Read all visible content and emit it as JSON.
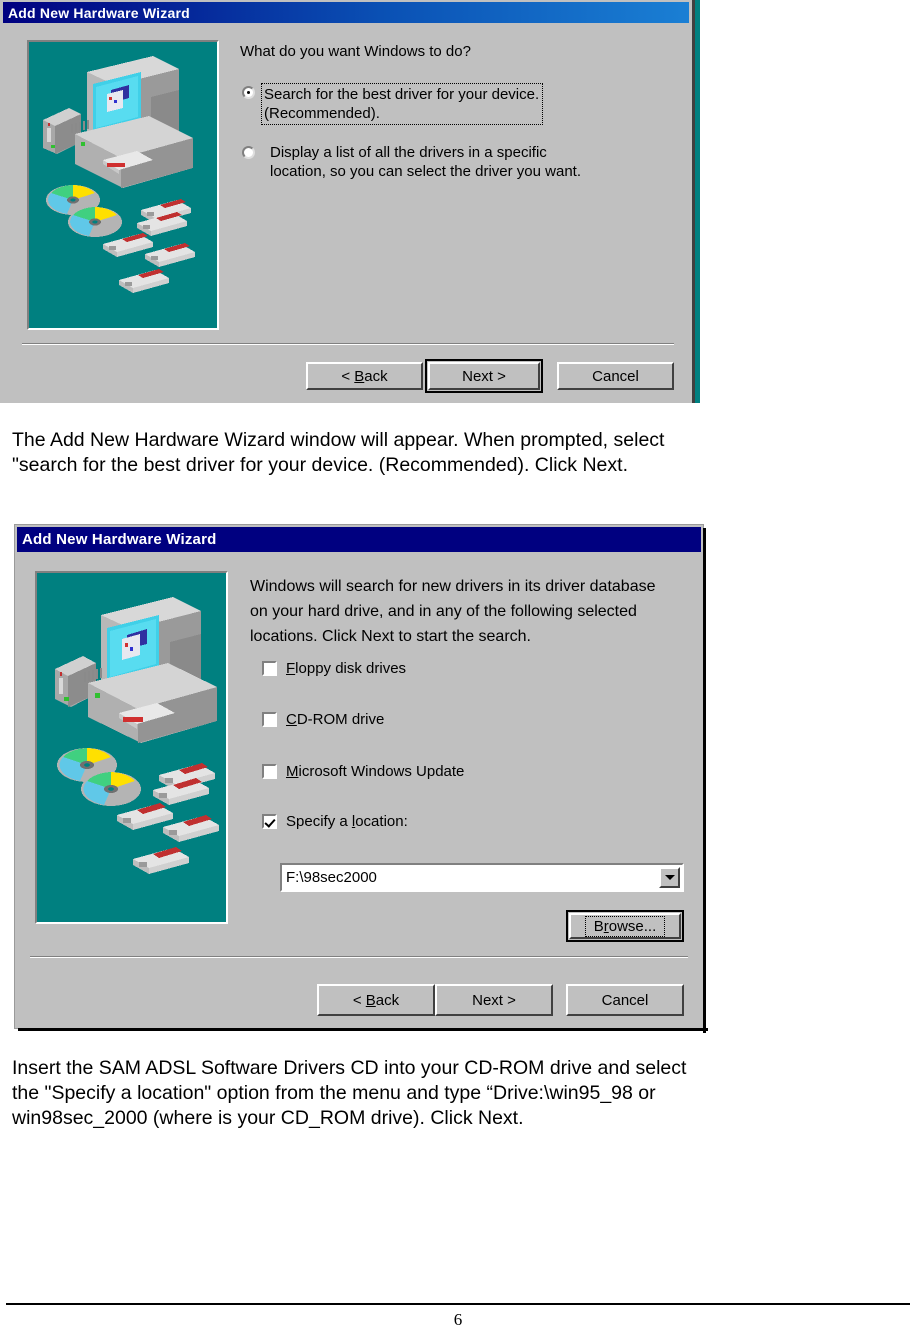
{
  "page": {
    "footer_page_number": "6"
  },
  "colors": {
    "titlebar_navy": "#000080",
    "titlebar_gradient_end": "#1a7fd4",
    "dialog_face": "#c0c0c0",
    "illustration_bg": "#008080",
    "text": "#000000"
  },
  "dialog1": {
    "title": "Add New Hardware Wizard",
    "prompt": "What do you want Windows to do?",
    "options": [
      {
        "label": "Search for the best driver for your device.\n(Recommended).",
        "selected": true,
        "focused": true
      },
      {
        "label": "Display a list of all the drivers in a specific\nlocation, so you can select the driver you want.",
        "selected": false,
        "focused": false
      }
    ],
    "buttons": [
      {
        "label": "< Back",
        "accel": "B",
        "default": false
      },
      {
        "label": "Next >",
        "accel": "",
        "default": true
      },
      {
        "label": "Cancel",
        "accel": "",
        "default": false
      }
    ],
    "illustration": "computer-media-illustration"
  },
  "caption1": "The Add New Hardware Wizard window will appear.  When prompted, select\n\"search for the best driver for your device.  (Recommended).  Click Next.",
  "dialog2": {
    "title": "Add New Hardware Wizard",
    "prompt": "Windows will search for new drivers in its driver database\non your hard drive, and in any of the following selected\nlocations. Click Next to start the search.",
    "checkboxes": [
      {
        "label": "Floppy disk drives",
        "accel": "F",
        "checked": false
      },
      {
        "label": "CD-ROM drive",
        "accel": "C",
        "checked": false
      },
      {
        "label": "Microsoft Windows Update",
        "accel": "M",
        "checked": false
      },
      {
        "label": "Specify a location:",
        "accel": "l",
        "checked": true
      }
    ],
    "location_combo": {
      "value": "F:\\98sec2000",
      "arrow_icon": "chevron-down-icon"
    },
    "browse_button": {
      "label": "Browse...",
      "accel": "B",
      "focused": true
    },
    "buttons": [
      {
        "label": "< Back",
        "accel": "B",
        "default": false
      },
      {
        "label": "Next >",
        "accel": "",
        "default": false
      },
      {
        "label": "Cancel",
        "accel": "",
        "default": false
      }
    ],
    "illustration": "computer-media-illustration"
  },
  "caption2": "Insert the SAM ADSL Software Drivers CD into your CD-ROM drive and select\nthe \"Specify a location\" option from the menu and type “Drive:\\win95_98 or\nwin98sec_2000 (where is your CD_ROM drive).  Click Next."
}
